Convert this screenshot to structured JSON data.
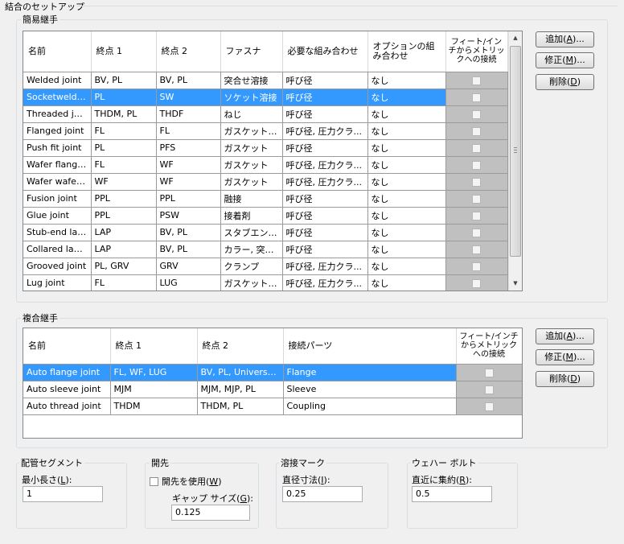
{
  "title": "結合のセットアップ",
  "simple": {
    "title": "簡易継手",
    "columns": [
      "名前",
      "終点 1",
      "終点 2",
      "ファスナ",
      "必要な組み合わせ",
      "オプションの組み合わせ",
      "フィート/インチからメトリックへの接続"
    ],
    "rows": [
      {
        "name": "Welded joint",
        "end1": "BV, PL",
        "end2": "BV, PL",
        "fastener": "突合せ溶接",
        "required": "呼び径",
        "optional": "なし",
        "checked": false
      },
      {
        "name": "Socketwelded...",
        "end1": "PL",
        "end2": "SW",
        "fastener": "ソケット溶接",
        "required": "呼び径",
        "optional": "なし",
        "checked": false
      },
      {
        "name": "Threaded joint",
        "end1": "THDM, PL",
        "end2": "THDF",
        "fastener": "ねじ",
        "required": "呼び径",
        "optional": "なし",
        "checked": false
      },
      {
        "name": "Flanged joint",
        "end1": "FL",
        "end2": "FL",
        "fastener": "ガスケット, ボ...",
        "required": "呼び径, 圧力クラ...",
        "optional": "なし",
        "checked": false
      },
      {
        "name": "Push fit joint",
        "end1": "PL",
        "end2": "PFS",
        "fastener": "ガスケット",
        "required": "呼び径",
        "optional": "なし",
        "checked": false
      },
      {
        "name": "Wafer flanged...",
        "end1": "FL",
        "end2": "WF",
        "fastener": "ガスケット",
        "required": "呼び径, 圧力クラ...",
        "optional": "なし",
        "checked": false
      },
      {
        "name": "Wafer wafer j...",
        "end1": "WF",
        "end2": "WF",
        "fastener": "ガスケット",
        "required": "呼び径, 圧力クラ...",
        "optional": "なし",
        "checked": false
      },
      {
        "name": "Fusion joint",
        "end1": "PPL",
        "end2": "PPL",
        "fastener": "融接",
        "required": "呼び径",
        "optional": "なし",
        "checked": false
      },
      {
        "name": "Glue joint",
        "end1": "PPL",
        "end2": "PSW",
        "fastener": "接着剤",
        "required": "呼び径",
        "optional": "なし",
        "checked": false
      },
      {
        "name": "Stub-end lapp...",
        "end1": "LAP",
        "end2": "BV, PL",
        "fastener": "スタブエンド, ...",
        "required": "呼び径",
        "optional": "なし",
        "checked": false
      },
      {
        "name": "Collared lappe...",
        "end1": "LAP",
        "end2": "BV, PL",
        "fastener": "カラー, 突合...",
        "required": "呼び径",
        "optional": "なし",
        "checked": false
      },
      {
        "name": "Grooved joint",
        "end1": "PL, GRV",
        "end2": "GRV",
        "fastener": "クランプ",
        "required": "呼び径, 圧力クラ...",
        "optional": "なし",
        "checked": false
      },
      {
        "name": "Lug joint",
        "end1": "FL",
        "end2": "LUG",
        "fastener": "ガスケット, ボ...",
        "required": "呼び径, 圧力クラ...",
        "optional": "なし",
        "checked": false
      }
    ],
    "buttons": {
      "add": "追加(",
      "add_key": "A",
      "edit": "修正(",
      "edit_key": "M",
      "delete": "削除(",
      "delete_key": "D",
      "close": ")..."
    }
  },
  "compound": {
    "title": "複合継手",
    "columns": [
      "名前",
      "終点 1",
      "終点 2",
      "接続パーツ",
      "フィート/インチからメトリックへの接続"
    ],
    "rows": [
      {
        "name": "Auto flange joint",
        "end1": "FL, WF, LUG",
        "end2": "BV, PL, Universal_...",
        "parts": "Flange",
        "checked": false
      },
      {
        "name": "Auto sleeve joint",
        "end1": "MJM",
        "end2": "MJM, MJP, PL",
        "parts": "Sleeve",
        "checked": false
      },
      {
        "name": "Auto thread joint",
        "end1": "THDM",
        "end2": "THDM, PL",
        "parts": "Coupling",
        "checked": false
      }
    ]
  },
  "segment": {
    "title": "配管セグメント",
    "min_length_label": "最小長さ(",
    "min_length_key": "L",
    "min_length_value": "1"
  },
  "gap": {
    "title": "開先",
    "use_gap_label": "開先を使用(",
    "use_gap_key": "W",
    "gap_size_label": "ギャップ サイズ(",
    "gap_size_key": "G",
    "gap_size_value": "0.125",
    "use_gap_checked": false
  },
  "weld": {
    "title": "溶接マーク",
    "diameter_label": "直径寸法(",
    "diameter_key": "I",
    "diameter_value": "0.25"
  },
  "wafer": {
    "title": "ウェハー ボルト",
    "round_label": "直近に集約(",
    "round_key": "R",
    "round_value": "0.5"
  }
}
